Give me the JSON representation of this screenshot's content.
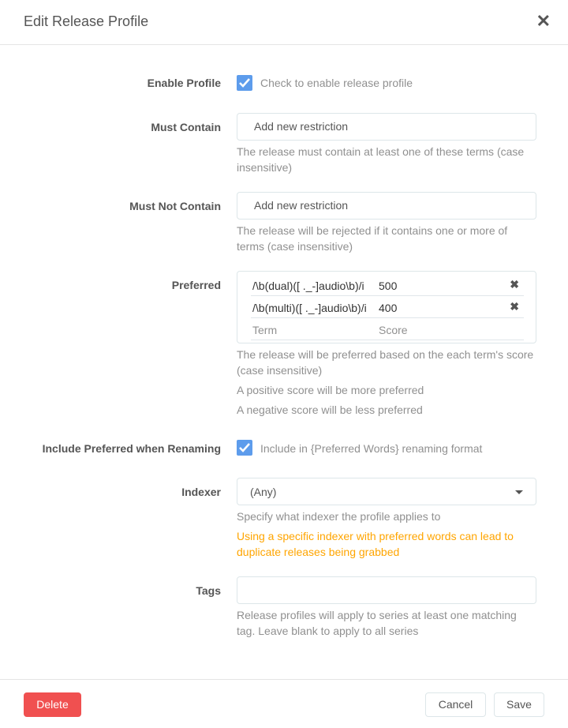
{
  "modal": {
    "title": "Edit Release Profile",
    "close_icon": "close-icon"
  },
  "enable_profile": {
    "label": "Enable Profile",
    "checked": true,
    "help": "Check to enable release profile"
  },
  "must_contain": {
    "label": "Must Contain",
    "placeholder": "Add new restriction",
    "help": "The release must contain at least one of these terms (case insensitive)"
  },
  "must_not_contain": {
    "label": "Must Not Contain",
    "placeholder": "Add new restriction",
    "help": "The release will be rejected if it contains one or more of terms (case insensitive)"
  },
  "preferred": {
    "label": "Preferred",
    "rows": [
      {
        "term": "/\\b(dual)([ ._-]audio\\b)/i",
        "score": "500"
      },
      {
        "term": "/\\b(multi)([ ._-]audio\\b)/i",
        "score": "400"
      }
    ],
    "term_placeholder": "Term",
    "score_placeholder": "Score",
    "help": [
      "The release will be preferred based on the each term's score (case insensitive)",
      "A positive score will be more preferred",
      "A negative score will be less preferred"
    ]
  },
  "include_preferred": {
    "label": "Include Preferred when Renaming",
    "checked": true,
    "help": "Include in {Preferred Words} renaming format"
  },
  "indexer": {
    "label": "Indexer",
    "value": "(Any)",
    "help": "Specify what indexer the profile applies to",
    "warning": "Using a specific indexer with preferred words can lead to duplicate releases being grabbed"
  },
  "tags": {
    "label": "Tags",
    "value": "",
    "help": "Release profiles will apply to series at least one matching tag. Leave blank to apply to all series"
  },
  "footer": {
    "delete_label": "Delete",
    "cancel_label": "Cancel",
    "save_label": "Save"
  },
  "colors": {
    "accent": "#5d9cec",
    "danger": "#f05050",
    "warning": "#ffa500"
  }
}
